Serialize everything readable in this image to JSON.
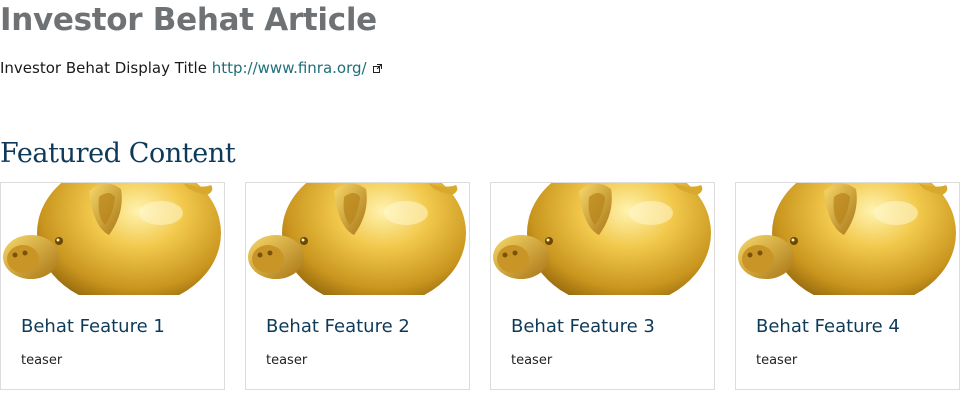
{
  "page": {
    "title": "Investor Behat Article",
    "display_title_label": "Investor Behat Display Title",
    "display_title_link": "http://www.finra.org/",
    "external_link_icon": "external-link-icon"
  },
  "featured": {
    "heading": "Featured Content",
    "image_icon": "golden-piggy-bank",
    "cards": [
      {
        "title": "Behat Feature 1",
        "teaser": "teaser"
      },
      {
        "title": "Behat Feature 2",
        "teaser": "teaser"
      },
      {
        "title": "Behat Feature 3",
        "teaser": "teaser"
      },
      {
        "title": "Behat Feature 4",
        "teaser": "teaser"
      }
    ]
  },
  "colors": {
    "title_gray": "#6f7274",
    "link_teal": "#1f6f78",
    "heading_navy": "#0e3a5a",
    "card_border": "#dcdcdc"
  }
}
